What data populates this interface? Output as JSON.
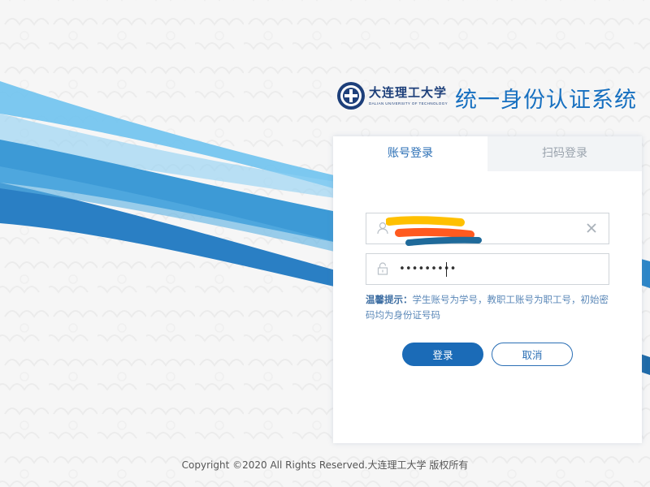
{
  "header": {
    "university_name": "大连理工大学",
    "university_name_en": "DALIAN UNIVERSITY OF TECHNOLOGY",
    "system_title": "统一身份认证系统"
  },
  "login": {
    "tabs": [
      {
        "label": "账号登录",
        "active": true
      },
      {
        "label": "扫码登录",
        "active": false
      }
    ],
    "username": {
      "value": "",
      "redacted": true,
      "icon": "user-icon",
      "clear_icon": "clear-icon"
    },
    "password": {
      "value": "•••••••••",
      "icon": "lock-icon"
    },
    "hint": {
      "label": "温馨提示：",
      "text": "学生账号为学号，教职工账号为职工号，初始密码均为身份证号码"
    },
    "buttons": {
      "login": "登录",
      "cancel": "取消"
    }
  },
  "footer": {
    "copyright": "Copyright ©2020 All Rights Reserved.大连理工大学 版权所有"
  },
  "colors": {
    "accent": "#1b6bb7",
    "title": "#1770c0",
    "hint": "#5b88b8",
    "ribbon_light": "#6cc0ee",
    "ribbon_dark": "#2d86c8",
    "redaction_yellow": "#ffc000",
    "redaction_orange": "#ff5a1f",
    "redaction_blue": "#1f6a9a"
  }
}
